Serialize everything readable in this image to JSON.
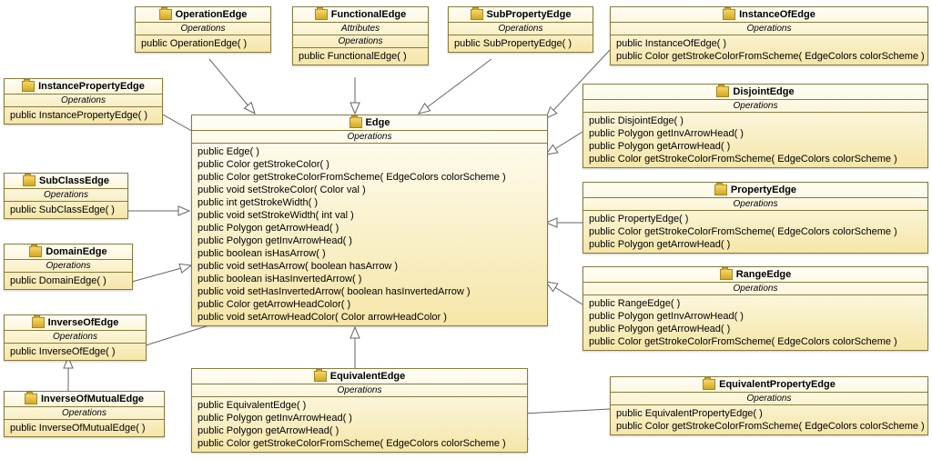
{
  "labels": {
    "operations": "Operations",
    "attributes": "Attributes"
  },
  "classes": {
    "OperationEdge": {
      "title": "OperationEdge",
      "ops": [
        "public OperationEdge(  )"
      ]
    },
    "FunctionalEdge": {
      "title": "FunctionalEdge",
      "ops": [
        "public FunctionalEdge(  )"
      ]
    },
    "SubPropertyEdge": {
      "title": "SubPropertyEdge",
      "ops": [
        "public SubPropertyEdge(  )"
      ]
    },
    "InstanceOfEdge": {
      "title": "InstanceOfEdge",
      "ops": [
        "public InstanceOfEdge(  )",
        "public Color  getStrokeColorFromScheme( EdgeColors colorScheme )"
      ]
    },
    "InstancePropertyEdge": {
      "title": "InstancePropertyEdge",
      "ops": [
        "public InstancePropertyEdge(  )"
      ]
    },
    "DisjointEdge": {
      "title": "DisjointEdge",
      "ops": [
        "public DisjointEdge(  )",
        "public Polygon  getInvArrowHead(  )",
        "public Polygon  getArrowHead(  )",
        "public Color  getStrokeColorFromScheme( EdgeColors colorScheme )"
      ]
    },
    "SubClassEdge": {
      "title": "SubClassEdge",
      "ops": [
        "public SubClassEdge(  )"
      ]
    },
    "PropertyEdge": {
      "title": "PropertyEdge",
      "ops": [
        "public PropertyEdge(  )",
        "public Color  getStrokeColorFromScheme( EdgeColors colorScheme )",
        "public Polygon  getArrowHead(  )"
      ]
    },
    "DomainEdge": {
      "title": "DomainEdge",
      "ops": [
        "public DomainEdge(  )"
      ]
    },
    "RangeEdge": {
      "title": "RangeEdge",
      "ops": [
        "public RangeEdge(  )",
        "public Polygon  getInvArrowHead(  )",
        "public Polygon  getArrowHead(  )",
        "public Color  getStrokeColorFromScheme( EdgeColors colorScheme )"
      ]
    },
    "InverseOfEdge": {
      "title": "InverseOfEdge",
      "ops": [
        "public InverseOfEdge(  )"
      ]
    },
    "InverseOfMutualEdge": {
      "title": "InverseOfMutualEdge",
      "ops": [
        "public InverseOfMutualEdge(  )"
      ]
    },
    "EquivalentEdge": {
      "title": "EquivalentEdge",
      "ops": [
        "public EquivalentEdge(  )",
        "public Polygon  getInvArrowHead(  )",
        "public Polygon  getArrowHead(  )",
        "public Color  getStrokeColorFromScheme( EdgeColors colorScheme )"
      ]
    },
    "EquivalentPropertyEdge": {
      "title": "EquivalentPropertyEdge",
      "ops": [
        "public EquivalentPropertyEdge(  )",
        "public Color  getStrokeColorFromScheme( EdgeColors colorScheme )"
      ]
    },
    "Edge": {
      "title": "Edge",
      "ops": [
        "public Edge(  )",
        "public Color  getStrokeColor(  )",
        "public Color  getStrokeColorFromScheme( EdgeColors colorScheme )",
        "public void  setStrokeColor( Color val )",
        "public int  getStrokeWidth(  )",
        "public void  setStrokeWidth( int val )",
        "public Polygon  getArrowHead(  )",
        "public Polygon  getInvArrowHead(  )",
        "public boolean  isHasArrow(  )",
        "public void  setHasArrow( boolean hasArrow )",
        "public boolean  isHasInvertedArrow(  )",
        "public void  setHasInvertedArrow( boolean hasInvertedArrow )",
        "public Color  getArrowHeadColor(  )",
        "public void  setArrowHeadColor( Color arrowHeadColor )"
      ]
    }
  }
}
